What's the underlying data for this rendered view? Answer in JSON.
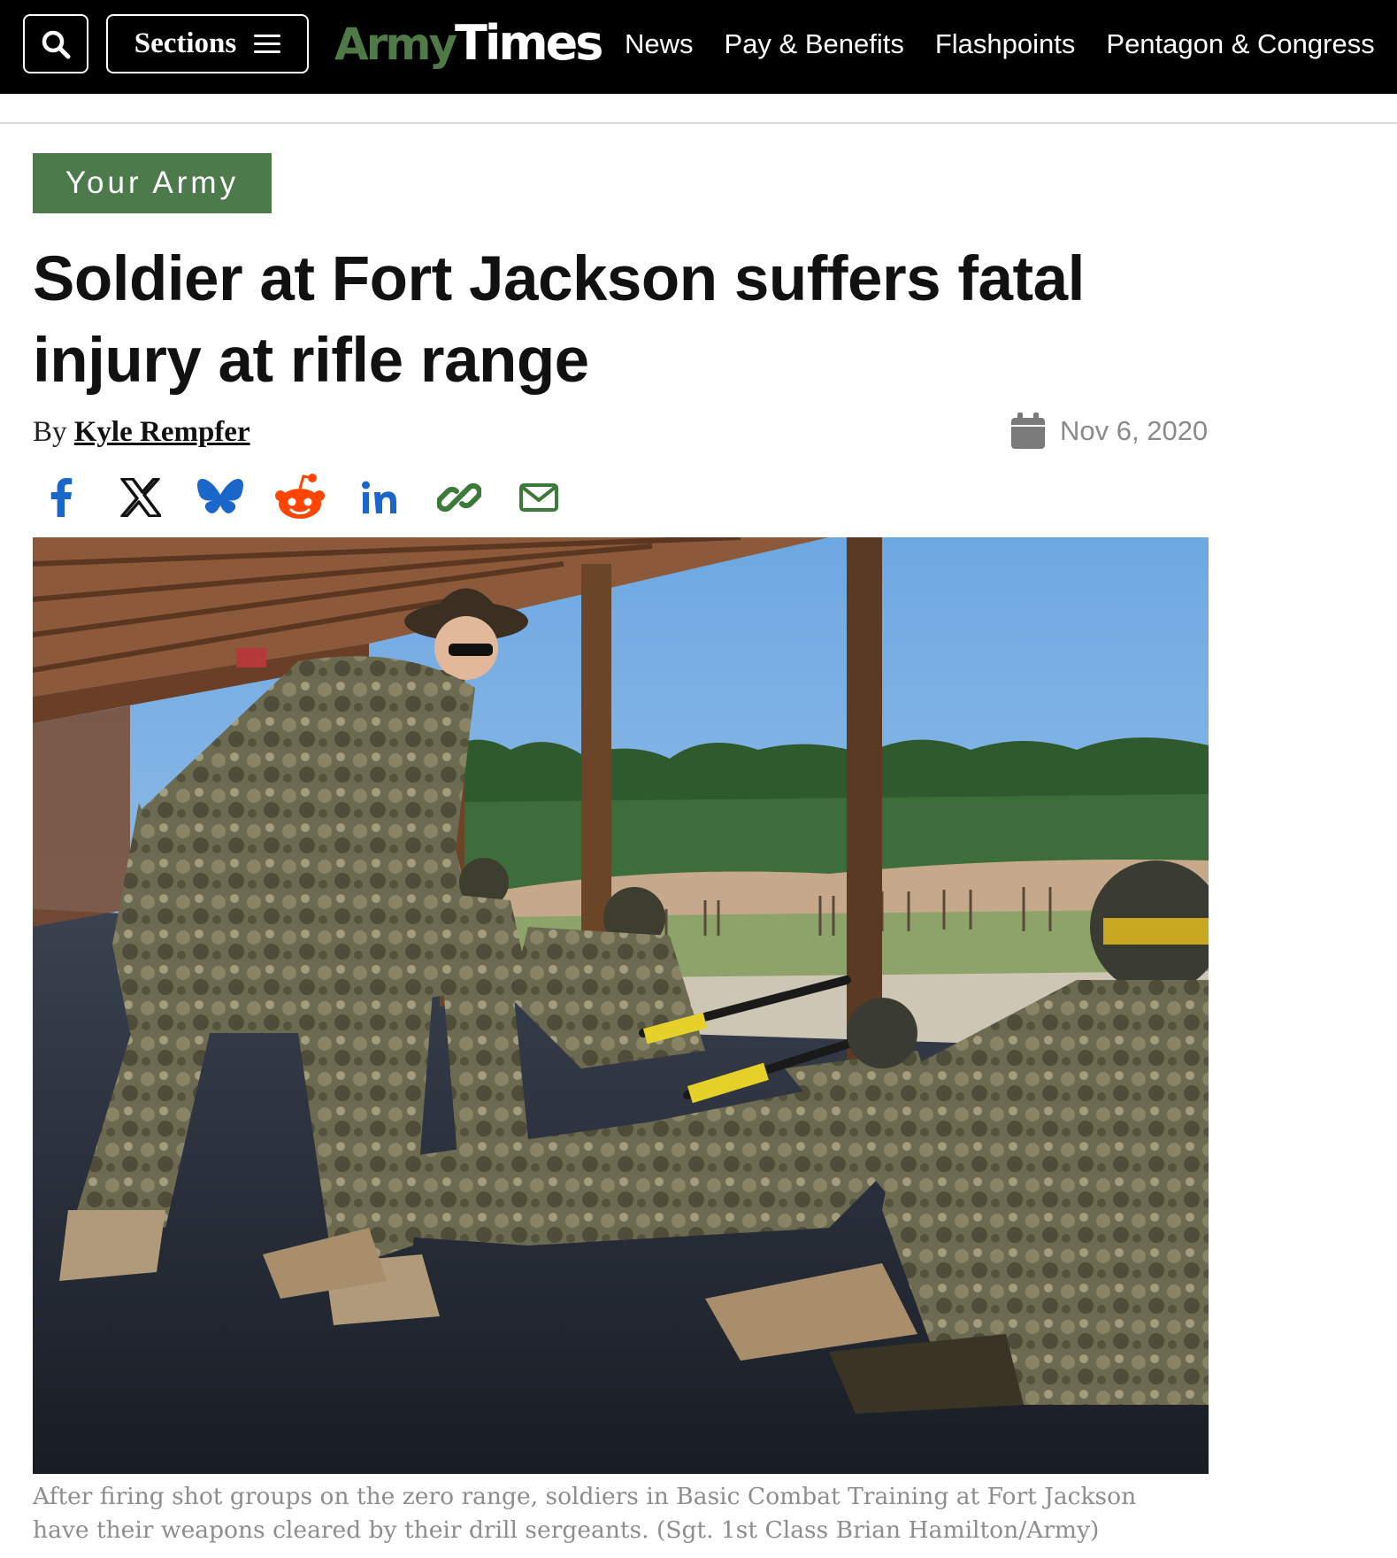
{
  "header": {
    "sections_label": "Sections",
    "logo_army": "Army",
    "logo_times": "Times",
    "nav": [
      "News",
      "Pay & Benefits",
      "Flashpoints",
      "Pentagon & Congress"
    ]
  },
  "article": {
    "category": "Your Army",
    "headline": "Soldier at Fort Jackson suffers fatal injury at rifle range",
    "byline_prefix": "By",
    "author": "Kyle Rempfer",
    "date": "Nov 6, 2020",
    "share_icons": [
      "facebook-icon",
      "x-icon",
      "bluesky-icon",
      "reddit-icon",
      "linkedin-icon",
      "link-icon",
      "email-icon"
    ],
    "photo_caption_line1": "After firing shot groups on the zero range, soldiers in Basic Combat Training at Fort Jackson",
    "photo_caption_line2": "have their weapons cleared by their drill sergeants. (Sgt. 1st Class Brian Hamilton/Army)"
  },
  "colors": {
    "army_green": "#4c7a4b",
    "share_blue": "#1a66c9",
    "reddit_orange": "#ff4500",
    "link_green": "#3c7a3a"
  }
}
